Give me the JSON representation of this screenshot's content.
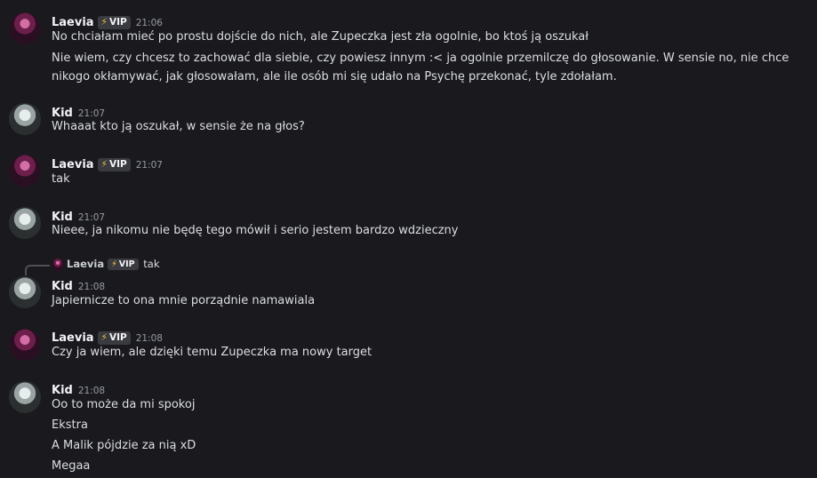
{
  "users": {
    "laevia": {
      "name": "Laevia",
      "badge": "VIP",
      "badge_icon": "lightning-icon"
    },
    "kid": {
      "name": "Kid"
    }
  },
  "messages": [
    {
      "author": "Laevia",
      "time": "21:06",
      "lines": [
        "No chciałam mieć po prostu dojście do nich, ale Zupeczka jest zła ogolnie, bo ktoś ją oszukał",
        "Nie wiem, czy chcesz to zachować dla siebie, czy powiesz innym :< ja ogolnie przemilczę do głosowanie. W sensie no, nie chce nikogo okłamywać, jak głosowałam, ale ile osób mi się udało na Psychę przekonać, tyle zdołałam."
      ]
    },
    {
      "author": "Kid",
      "time": "21:07",
      "lines": [
        "Whaaat kto ją oszukał, w sensie że na głos?"
      ]
    },
    {
      "author": "Laevia",
      "time": "21:07",
      "lines": [
        "tak"
      ]
    },
    {
      "author": "Kid",
      "time": "21:07",
      "lines": [
        "Nieee, ja nikomu nie będę tego mówił i serio jestem bardzo wdzieczny"
      ]
    },
    {
      "author": "Kid",
      "time": "21:08",
      "reply": {
        "author": "Laevia",
        "badge": "VIP",
        "text": "tak"
      },
      "lines": [
        "Japiernicze to ona mnie porządnie namawiala"
      ]
    },
    {
      "author": "Laevia",
      "time": "21:08",
      "lines": [
        "Czy ja wiem, ale dzięki temu Zupeczka ma nowy target"
      ]
    },
    {
      "author": "Kid",
      "time": "21:08",
      "lines": [
        "Oo to może da mi spokoj",
        "Ekstra",
        "A Malik pójdzie za nią xD",
        "Megaa"
      ]
    }
  ]
}
